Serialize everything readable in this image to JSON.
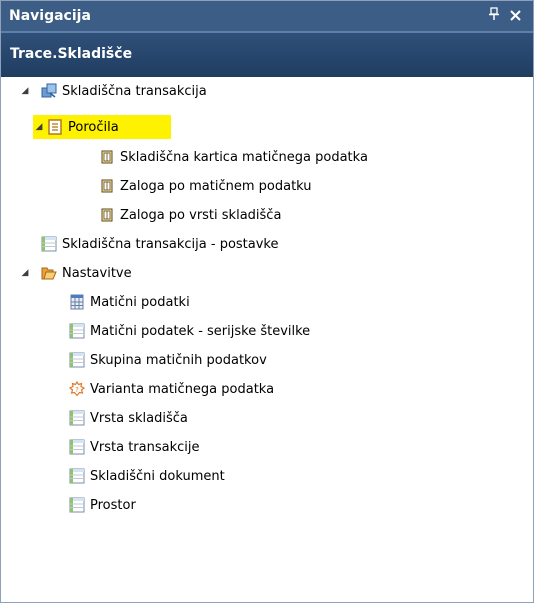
{
  "header": {
    "title": "Navigacija",
    "pin_glyph": "ѹ",
    "close_glyph": "✕"
  },
  "subheader": {
    "label": "Trace.Skladišče"
  },
  "tree": {
    "skladiscna_transakcija": "Skladiščna transakcija",
    "porocila": "Poročila",
    "report1": "Skladiščna kartica matičnega podatka",
    "report2": "Zaloga po matičnem podatku",
    "report3": "Zaloga po vrsti skladišča",
    "postavke": "Skladiščna transakcija - postavke",
    "nastavitve": "Nastavitve",
    "items": [
      "Matični podatki",
      "Matični podatek - serijske številke",
      "Skupina matičnih podatkov",
      "Varianta matičnega podatka",
      "Vrsta skladišča",
      "Vrsta transakcije",
      "Skladiščni dokument",
      "Prostor"
    ]
  },
  "colors": {
    "titlebar": "#3b5d86",
    "subheader": "#2a4a72",
    "selection": "#fff200"
  }
}
